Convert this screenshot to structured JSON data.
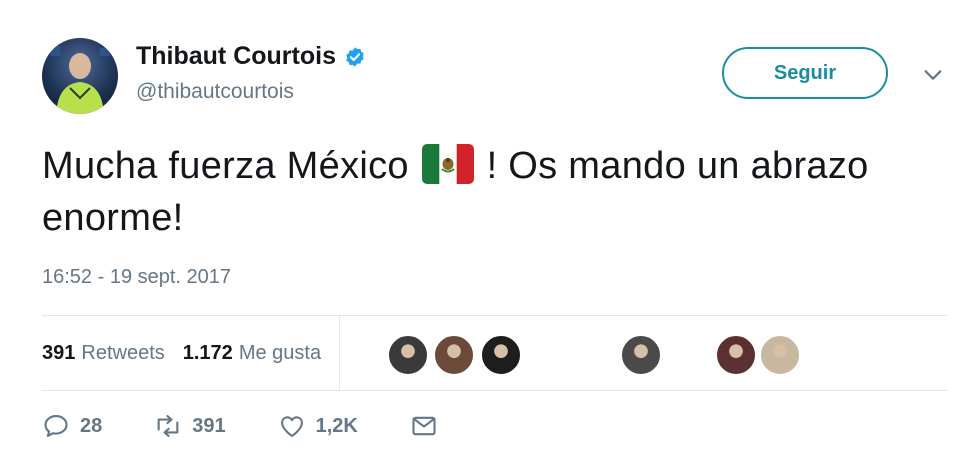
{
  "author": {
    "name": "Thibaut Courtois",
    "handle": "@thibautcourtois",
    "verified_icon": "verified-badge-icon",
    "avatar_icon": "avatar"
  },
  "follow_button": {
    "label": "Seguir"
  },
  "menu_icon": "chevron-down-icon",
  "tweet": {
    "text_before_flag": "Mucha fuerza México",
    "flag_icon": "mexico-flag-icon",
    "text_after_flag": "! Os mando un abrazo enorme!"
  },
  "timestamp": "16:52 - 19 sept. 2017",
  "stats": {
    "retweets_count": "391",
    "retweets_label": "Retweets",
    "likes_count": "1.172",
    "likes_label": "Me gusta"
  },
  "likers": [
    {
      "name": "liker-avatar-1",
      "color": "#3a3a3a"
    },
    {
      "name": "liker-avatar-2",
      "color": "#6b4a3a"
    },
    {
      "name": "liker-avatar-3",
      "color": "#1e1e1e"
    },
    {
      "name": "liker-avatar-4",
      "color": "#4a4a4a"
    },
    {
      "name": "liker-avatar-5",
      "color": "#5a3030"
    },
    {
      "name": "liker-avatar-6",
      "color": "#c8b8a0"
    }
  ],
  "actions": {
    "reply_icon": "reply-icon",
    "reply_count": "28",
    "retweet_icon": "retweet-icon",
    "retweet_count": "391",
    "like_icon": "heart-icon",
    "like_count": "1,2K",
    "message_icon": "envelope-icon"
  },
  "colors": {
    "accent": "#1b8da0",
    "secondary_text": "#657786",
    "primary_text": "#14171a",
    "verified": "#1da1f2",
    "divider": "#e1e8ed"
  }
}
